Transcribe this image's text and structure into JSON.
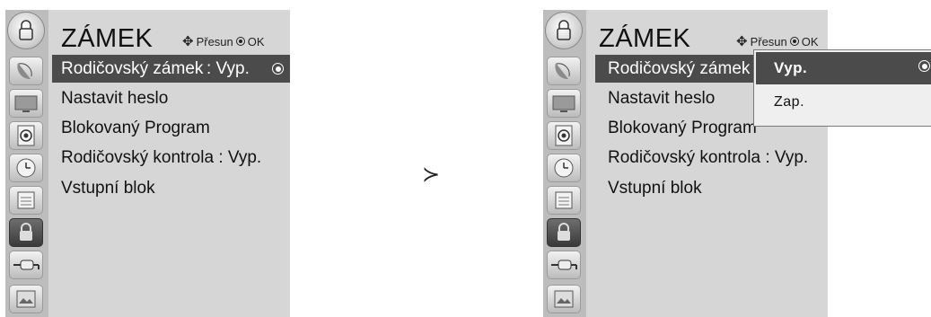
{
  "screen_before": {
    "title": "ZÁMEK",
    "hint_arrows": "✧",
    "hint_move": "Přesun",
    "hint_ok": "OK",
    "items": [
      {
        "label": "Rodičovský zámek",
        "value": ": Vyp."
      },
      {
        "label": "Nastavit heslo",
        "value": ""
      },
      {
        "label": "Blokovaný Program",
        "value": ""
      },
      {
        "label": "Rodičovský kontrola",
        "value": ": Vyp."
      },
      {
        "label": "Vstupní blok",
        "value": ""
      }
    ],
    "icons": [
      "lock-menu-icon",
      "satellite-dish-icon",
      "tv-icon",
      "speaker-icon",
      "clock-icon",
      "calendar-icon",
      "lock-icon",
      "connector-icon",
      "picture-icon"
    ],
    "selected_icon": "lock-icon"
  },
  "separator": "≻",
  "screen_after": {
    "title": "ZÁMEK",
    "hint_move": "Přesun",
    "hint_ok": "OK",
    "items": [
      {
        "label": "Rodičovský zámek",
        "value": ""
      },
      {
        "label": "Nastavit heslo",
        "value": ""
      },
      {
        "label": "Blokovaný Program",
        "value": ""
      },
      {
        "label": "Rodičovský kontrola",
        "value": ": Vyp."
      },
      {
        "label": "Vstupní blok",
        "value": ""
      }
    ],
    "popup": {
      "options": [
        "Vyp.",
        "Zap."
      ],
      "selected": "Vyp."
    }
  },
  "colors": {
    "panel": "#d6d6d6",
    "icon_column": "#bdbdbd",
    "highlight": "#4b4b4b"
  }
}
